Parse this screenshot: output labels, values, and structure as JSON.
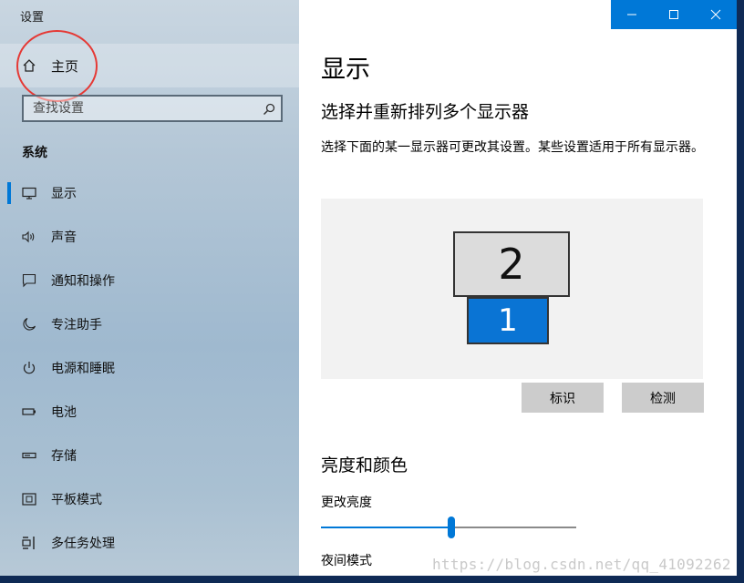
{
  "window": {
    "title": "设置"
  },
  "sidebar": {
    "home_label": "主页",
    "search_placeholder": "查找设置",
    "section_label": "系统",
    "items": [
      {
        "label": "显示",
        "icon": "monitor-icon",
        "selected": true
      },
      {
        "label": "声音",
        "icon": "speaker-icon",
        "selected": false
      },
      {
        "label": "通知和操作",
        "icon": "message-icon",
        "selected": false
      },
      {
        "label": "专注助手",
        "icon": "moon-icon",
        "selected": false
      },
      {
        "label": "电源和睡眠",
        "icon": "power-icon",
        "selected": false
      },
      {
        "label": "电池",
        "icon": "battery-icon",
        "selected": false
      },
      {
        "label": "存储",
        "icon": "storage-icon",
        "selected": false
      },
      {
        "label": "平板模式",
        "icon": "tablet-icon",
        "selected": false
      },
      {
        "label": "多任务处理",
        "icon": "multitask-icon",
        "selected": false
      }
    ]
  },
  "main": {
    "title": "显示",
    "rearrange_heading": "选择并重新排列多个显示器",
    "rearrange_desc": "选择下面的某一显示器可更改其设置。某些设置适用于所有显示器。",
    "monitors": [
      {
        "number": "2"
      },
      {
        "number": "1"
      }
    ],
    "identify_button": "标识",
    "detect_button": "检测",
    "brightness_heading": "亮度和颜色",
    "brightness_label": "更改亮度",
    "brightness_value": 0.51,
    "night_mode_label": "夜间模式"
  },
  "watermark": "https://blog.csdn.net/qq_41092262",
  "colors": {
    "accent": "#0078d7",
    "annotation": "#e53935"
  }
}
